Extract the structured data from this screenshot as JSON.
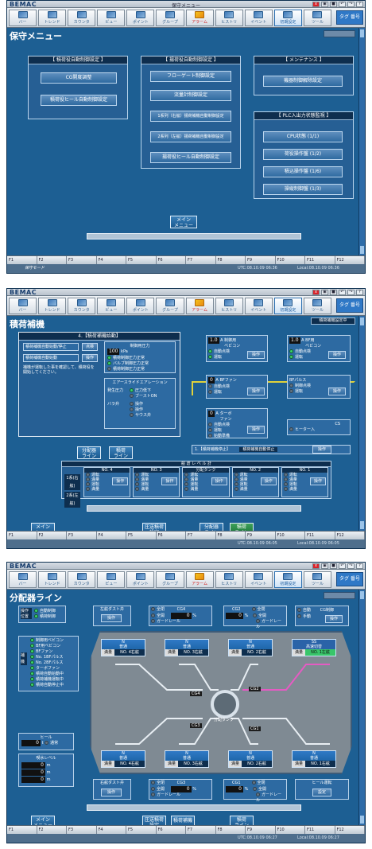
{
  "app": {
    "logo": "BEMAC",
    "tag_button": "タグ 番号"
  },
  "toolbar": [
    {
      "label": "バー",
      "icon": "bar-icon"
    },
    {
      "label": "トレンド",
      "icon": "trend-icon"
    },
    {
      "label": "カウンタ",
      "icon": "counter-icon"
    },
    {
      "label": "ビュー",
      "icon": "view-icon"
    },
    {
      "label": "ポイント",
      "icon": "point-icon"
    },
    {
      "label": "グループ",
      "icon": "group-icon"
    },
    {
      "label": "アラーム",
      "icon": "alarm-icon"
    },
    {
      "label": "ヒストリ",
      "icon": "history-icon"
    },
    {
      "label": "イベント",
      "icon": "event-icon"
    },
    {
      "label": "初期設定",
      "icon": "settings-icon"
    },
    {
      "label": "ツール",
      "icon": "tool-icon"
    }
  ],
  "fkeys": [
    "F1",
    "F2",
    "F3",
    "F4",
    "F5",
    "F6",
    "F7",
    "F8",
    "F9",
    "F10",
    "F11",
    "F12"
  ],
  "screen1": {
    "window_title": "保守メニュー",
    "page_title": "保守メニュー",
    "sec1": {
      "title": "【 積荷役自動制御設定 】",
      "buttons": [
        "CG開度調整",
        "積荷役ヒール自動制御設定"
      ]
    },
    "sec2": {
      "title": "【 揚荷役自動制御設定 】",
      "buttons": [
        "フローゲート制御設定",
        "流量計制御設定",
        "1系列（右舷）揚荷補機自動制御設定",
        "2系列（左舷）揚荷補機自動制御設定",
        "揚荷役ヒール自動制御設定"
      ]
    },
    "sec3": {
      "title": "【 メンテナンス 】",
      "buttons": [
        "機器制御解除設定"
      ]
    },
    "sec4": {
      "title": "【 PLC入出力状態監視 】",
      "buttons": [
        "CPU状態 (1/1)",
        "荷役操作盤 (1/2)",
        "積込操作盤 (1/6)",
        "操縦制御盤 (1/3)"
      ]
    },
    "menu_button": "メイン\nメニュー",
    "status": {
      "left": "保守モード",
      "utc": "UTC:08.10.09 06:36",
      "local": "Local:08.10.09 06:36"
    }
  },
  "screen2": {
    "page_title": "積荷補機",
    "badge": "積荷補機設定中",
    "panel_title": "4.【積荷補機始動】",
    "left_rows": [
      {
        "text": "積荷補機自動始動/停止",
        "btn": "点検"
      },
      {
        "text": "積荷補機自動始動",
        "btn": "操作"
      }
    ],
    "note": "補機が運転した事を確認して、積荷役を開始してください。",
    "pressure_title": "制御用圧力",
    "pressure_value": "100",
    "pressure_unit": "kPa",
    "pressure_checks": [
      "積荷制御圧力正常",
      "バルブ制御圧力正常",
      "積荷制御圧力正常"
    ],
    "air_title": "エアースライドエアレーション",
    "air_rows": [
      {
        "label": "発生圧力",
        "items": [
          "圧力低下",
          "ブーストON"
        ]
      },
      {
        "label": "バラ弁",
        "items": [
          "操作",
          "操作",
          "サウス弁"
        ]
      }
    ],
    "left_buttons": [
      "分配器\nライン",
      "積荷\nライン"
    ],
    "devices": [
      {
        "name": "制御用\nベビコン",
        "value": "1.0",
        "unit": "A",
        "s1": "自動点検",
        "s2": "運転",
        "btn": "操作"
      },
      {
        "name": "BF用\nベビコン",
        "value": "1.0",
        "unit": "A",
        "s1": "自動点検",
        "s2": "運転",
        "btn": "操作"
      },
      {
        "name": "BFファン",
        "value": "0",
        "unit": "A",
        "s1": "自動点検",
        "s2": "運転",
        "btn": "操作"
      },
      {
        "name": "BFパルス",
        "value": "",
        "unit": "",
        "s1": "制御点検",
        "s2": "運転",
        "btn": "操作"
      },
      {
        "name": "ターボ\nファン",
        "value": "0",
        "unit": "A",
        "s1": "自動点検",
        "s2": "運転",
        "s3": "始動準備",
        "btn": "操作"
      }
    ],
    "cs_label": "CS",
    "cs_option": "ヒーター入",
    "stop_row": {
      "label": "1.【積荷補機停止】",
      "text": "積荷補機自動停止",
      "btn": "操作"
    },
    "level_title": "船 倉 レ ベ ル 計",
    "holds": [
      "NO. 4",
      "NO. 3",
      "分配タンク",
      "NO. 2",
      "NO. 1"
    ],
    "hold_side": [
      "1系(右舷)",
      "2系(左舷)"
    ],
    "hold_items": [
      "運転",
      "満量",
      "操作"
    ],
    "bottom_buttons": [
      "メイン\nメニュー",
      "圧送積荷\n設定",
      "分配器\nライン",
      "積荷\nライン"
    ],
    "status": {
      "left": "",
      "utc": "UTC:08.10.09 06:05",
      "local": "Local:08.10.09 06:05"
    }
  },
  "screen3": {
    "page_title": "分配器ライン",
    "op_title": "操作位置",
    "op_items": [
      "自動制御",
      "積荷制御"
    ],
    "tests": [
      {
        "name": "左舷ダスト弁",
        "btn": "操作"
      },
      {
        "name": "右舷ダスト弁",
        "btn": "操作"
      }
    ],
    "cg": [
      {
        "name": "CG4",
        "value": "0",
        "unit": "%",
        "items": [
          "全閉",
          "全開",
          "ガードレール"
        ]
      },
      {
        "name": "CG2",
        "value": "0",
        "unit": "%",
        "items": [
          "全閉",
          "全開",
          "ガードレール"
        ]
      },
      {
        "name": "CG3",
        "value": "0",
        "unit": "%",
        "items": [
          "全閉",
          "全開",
          "ガードレール"
        ]
      },
      {
        "name": "CG1",
        "value": "0",
        "unit": "%",
        "items": [
          "全閉",
          "全開",
          "ガードレール"
        ]
      }
    ],
    "cg_ctrl": {
      "title": "CG制御",
      "items": [
        "自動",
        "手動"
      ],
      "btn": "操作"
    },
    "interlocks": [
      "制御用ベビコン",
      "BF用ベビコン",
      "BFファン",
      "No. 1BFパルス",
      "No. 2BFパルス",
      "ターボファン",
      "積荷自動始動中",
      "積荷補機運転中",
      "積荷自動停止中"
    ],
    "side_label": "補機",
    "heel": {
      "title": "ヒール",
      "value": "0",
      "unit": "t",
      "check": "通常"
    },
    "draft": {
      "title": "喫水レベル",
      "rows": [
        {
          "v": "0",
          "u": "m"
        },
        {
          "v": "0",
          "u": "m"
        },
        {
          "v": "0",
          "u": "m"
        }
      ]
    },
    "holds_top": [
      {
        "label": "N\n普通",
        "tank": "NO. 4右舷"
      },
      {
        "label": "N\n普通",
        "tank": "NO. 3右舷"
      },
      {
        "label": "N\n普通",
        "tank": "NO. 2右舷"
      },
      {
        "label": "SS\n高速切替",
        "tank": "NO. 1左舷"
      }
    ],
    "holds_bot": [
      {
        "label": "N\n普通",
        "tank": "NO. 4右舷"
      },
      {
        "label": "N\n普通",
        "tank": "NO. 3右舷"
      },
      {
        "label": "N\n普通",
        "tank": "NO. 2右舷"
      },
      {
        "label": "N\n普通",
        "tank": "NO. 1右舷"
      }
    ],
    "tank_state": "満量",
    "center_labels": [
      "CG4",
      "CG2",
      "CG3",
      "CG1",
      "分配タンク"
    ],
    "speed_box": {
      "title": "ヒール運転",
      "btn": "設定"
    },
    "bottom_buttons": [
      "メイン\nメニュー",
      "圧送積荷\n設定",
      "積荷補機",
      "積荷\nライン"
    ],
    "status": {
      "left": "",
      "utc": "UTC:08.10.09 06:27",
      "local": "Local:08.10.09 06:27"
    }
  },
  "colors": {
    "panel_bg": "#1d5f93",
    "accent_green": "#39c66a",
    "pink_line": "#e55bc3",
    "yellow_line": "#e0d23a"
  }
}
